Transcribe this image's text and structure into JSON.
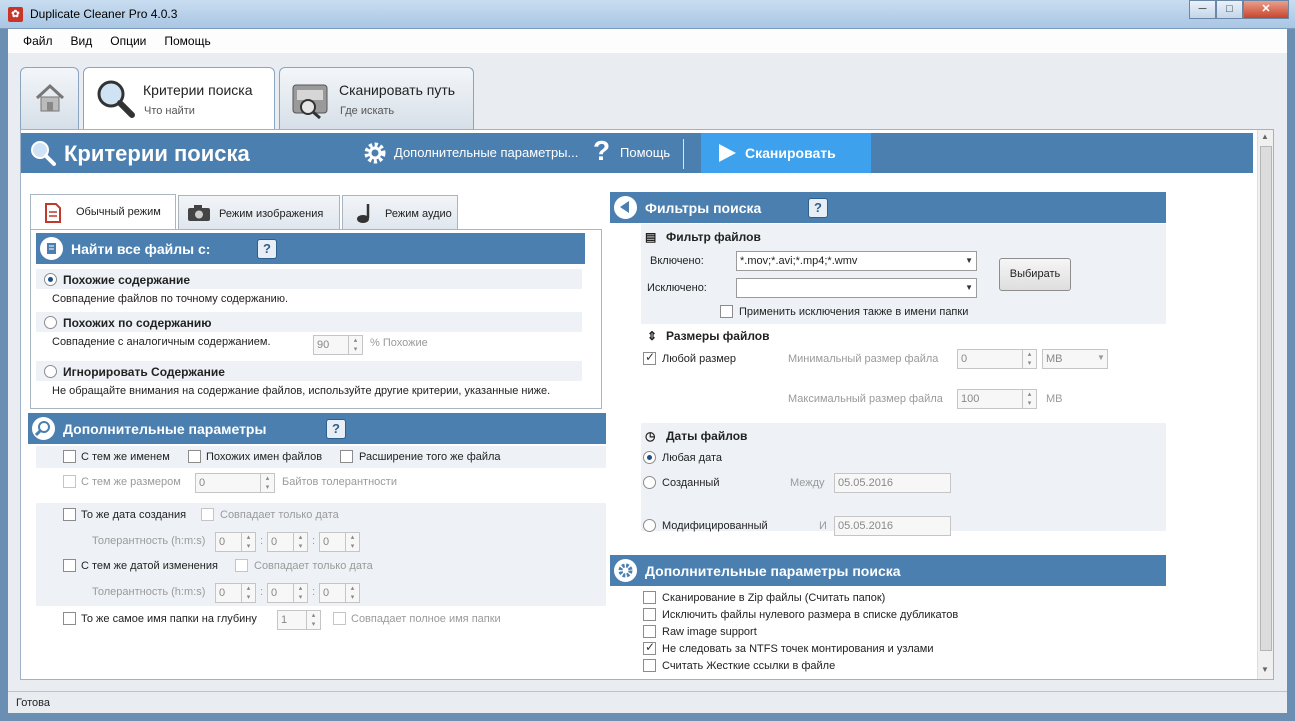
{
  "window": {
    "title": "Duplicate Cleaner Pro 4.0.3",
    "min": "─",
    "max": "□",
    "close": "✕"
  },
  "menu": [
    "Файл",
    "Вид",
    "Опции",
    "Помощь"
  ],
  "top_tabs": [
    {
      "title": "Критерии поиска",
      "subtitle": "Что найти"
    },
    {
      "title": "Сканировать путь",
      "subtitle": "Где искать"
    }
  ],
  "banner": {
    "title": "Критерии поиска",
    "extra": "Дополнительные параметры...",
    "help": "Помощь",
    "scan": "Сканировать"
  },
  "mode_tabs": [
    "Обычный режим",
    "Режим изображения",
    "Режим аудио"
  ],
  "find_all": {
    "header": "Найти все файлы с:",
    "help": "?",
    "options": [
      {
        "label": "Похожие содержание",
        "desc": "Совпадение файлов по точному содержанию.",
        "checked": true
      },
      {
        "label": "Похожих по содержанию",
        "desc": "Совпадение с аналогичным содержанием.",
        "checked": false,
        "value": "90",
        "unit": "% Похожие"
      },
      {
        "label": "Игнорировать Содержание",
        "desc": "Не обращайте внимания на содержание файлов, используйте другие критерии, указанные ниже.",
        "checked": false
      }
    ]
  },
  "extra_params": {
    "header": "Дополнительные параметры",
    "help": "?",
    "same_name": "С тем же именем",
    "similar_names": "Похожих имен файлов",
    "same_ext": "Расширение того же файла",
    "same_size": "С тем же размером",
    "size_value": "0",
    "size_unit": "Байтов толерантности",
    "same_created": "То же дата создания",
    "date_only": "Совпадает только дата",
    "tolerance": "Толерантность (h:m:s)",
    "zero": "0",
    "colon": ":",
    "same_modified": "С тем же датой изменения",
    "date_only2": "Совпадает только дата",
    "same_folder": "То же самое имя папки на глубину",
    "depth_value": "1",
    "full_folder": "Совпадает полное имя папки"
  },
  "filters": {
    "header": "Фильтры поиска",
    "help": "?",
    "file_filter": "Фильтр файлов",
    "included_label": "Включено:",
    "included_value": "*.mov;*.avi;*.mp4;*.wmv",
    "excluded_label": "Исключено:",
    "excluded_value": "",
    "choose_btn": "Выбирать",
    "apply_excl": "Применить исключения также в имени папки",
    "sizes_header": "Размеры файлов",
    "any_size": "Любой размер",
    "min_size": "Минимальный размер файла",
    "min_value": "0",
    "min_unit": "MB",
    "max_size": "Максимальный размер файла",
    "max_value": "100",
    "max_unit": "MB",
    "dates_header": "Даты файлов",
    "any_date": "Любая дата",
    "created": "Созданный",
    "between": "Между",
    "date1": "05.05.2016",
    "modified": "Модифицированный",
    "and": "И",
    "date2": "05.05.2016"
  },
  "adv": {
    "header": "Дополнительные параметры поиска",
    "items": [
      {
        "label": "Сканирование в Zip файлы (Считать папок)",
        "checked": false
      },
      {
        "label": "Исключить файлы нулевого размера в списке дубликатов",
        "checked": false
      },
      {
        "label": "Raw image support",
        "checked": false
      },
      {
        "label": "Не следовать за NTFS точек монтирования и узлами",
        "checked": true
      },
      {
        "label": "Считать Жесткие ссылки в файле",
        "checked": false
      }
    ]
  },
  "status": "Готова",
  "colors": {
    "banner": "#4a7fb0",
    "scan": "#3da1ee",
    "titlebar": "#bcd3ea"
  }
}
